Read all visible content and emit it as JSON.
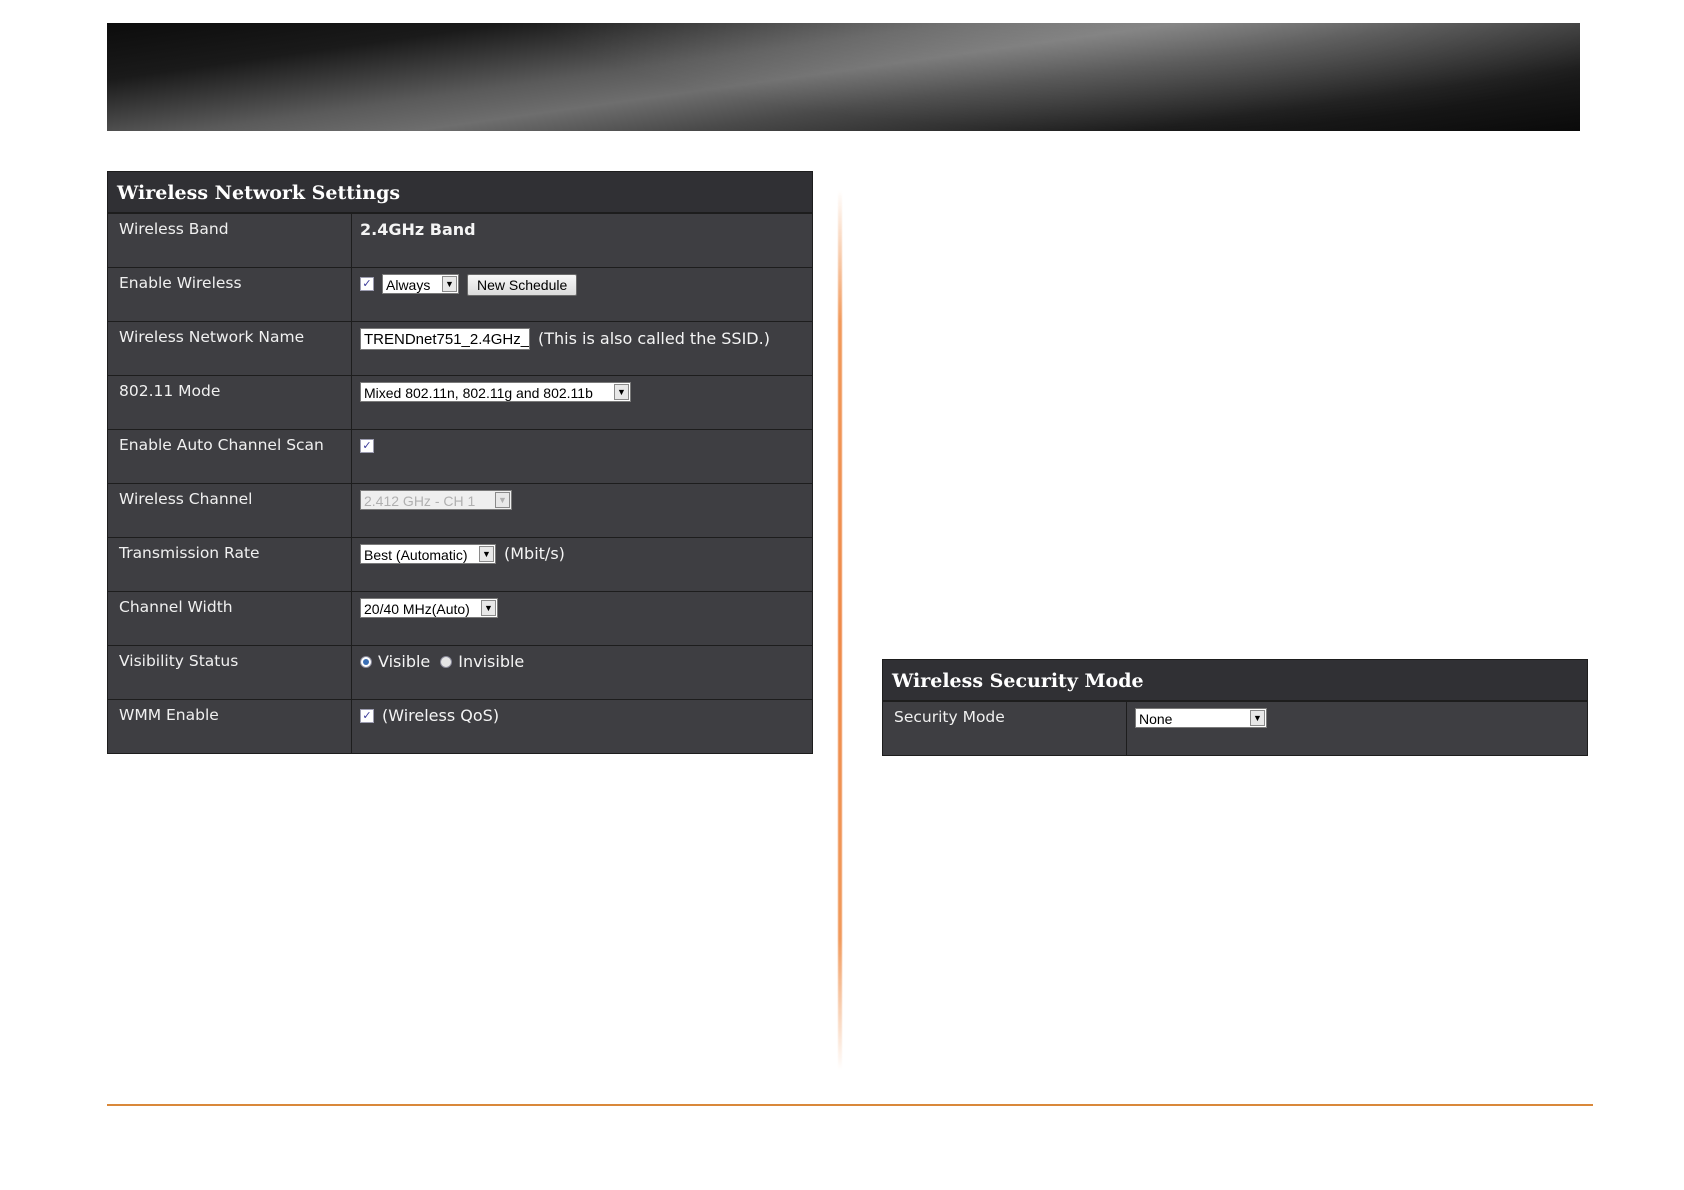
{
  "network": {
    "title": "Wireless Network Settings",
    "band_label": "Wireless Band",
    "band_value": "2.4GHz Band",
    "enable_label": "Enable Wireless",
    "enable_checked": true,
    "schedule_value": "Always",
    "new_schedule_label": "New Schedule",
    "ssid_label": "Wireless Network Name",
    "ssid_value": "TRENDnet751_2.4GHz_",
    "ssid_hint": "(This is also called the SSID.)",
    "mode_label": "802.11 Mode",
    "mode_value": "Mixed 802.11n, 802.11g and 802.11b",
    "autoscan_label": "Enable Auto Channel Scan",
    "autoscan_checked": true,
    "channel_label": "Wireless Channel",
    "channel_value": "2.412 GHz - CH 1",
    "rate_label": "Transmission Rate",
    "rate_value": "Best (Automatic)",
    "rate_unit": "(Mbit/s)",
    "width_label": "Channel Width",
    "width_value": "20/40 MHz(Auto)",
    "visibility_label": "Visibility Status",
    "visible_label": "Visible",
    "invisible_label": "Invisible",
    "visibility_selected": "Visible",
    "wmm_label": "WMM Enable",
    "wmm_checked": true,
    "wmm_hint": "(Wireless QoS)"
  },
  "security": {
    "title": "Wireless Security Mode",
    "mode_label": "Security Mode",
    "mode_value": "None"
  },
  "colors": {
    "panel_bg": "#3e3e42",
    "accent_line": "#d9883a",
    "divider": "#ee8a4a"
  }
}
